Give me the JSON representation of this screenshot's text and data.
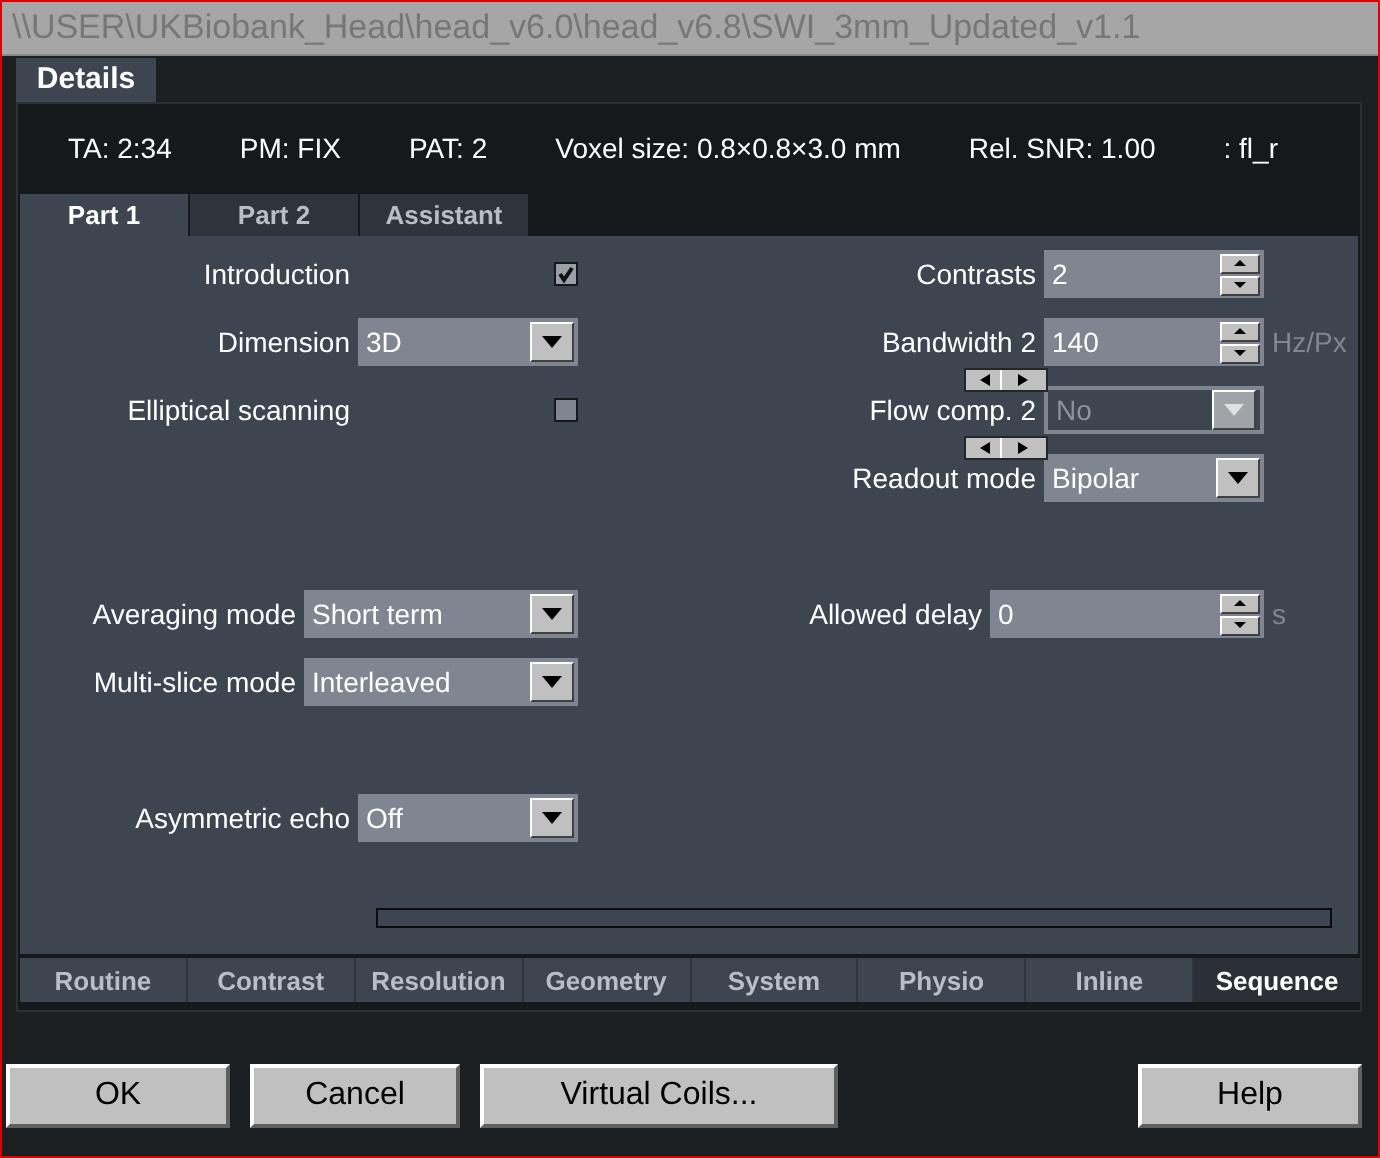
{
  "window": {
    "title": "\\\\USER\\UKBiobank_Head\\head_v6.0\\head_v6.8\\SWI_3mm_Updated_v1.1"
  },
  "top_tab": {
    "label": "Details",
    "selected": true
  },
  "info": [
    "TA: 2:34",
    "PM: FIX",
    "PAT: 2",
    "Voxel size: 0.8×0.8×3.0 mm",
    "Rel. SNR: 1.00",
    ": fl_r"
  ],
  "sub_tabs": [
    {
      "label": "Part 1",
      "selected": true
    },
    {
      "label": "Part 2",
      "selected": false
    },
    {
      "label": "Assistant",
      "selected": false
    }
  ],
  "left_groups": [
    [
      {
        "kind": "checkbox",
        "label": "Introduction",
        "checked": true
      },
      {
        "kind": "dropdown",
        "label": "Dimension",
        "value": "3D"
      },
      {
        "kind": "checkbox",
        "label": "Elliptical scanning",
        "checked": false
      }
    ],
    [
      {
        "kind": "dropdown",
        "label": "Averaging mode",
        "value": "Short term"
      },
      {
        "kind": "dropdown",
        "label": "Multi-slice mode",
        "value": "Interleaved"
      }
    ],
    [
      {
        "kind": "dropdown",
        "label": "Asymmetric echo",
        "value": "Off"
      }
    ]
  ],
  "right_groups": [
    [
      {
        "kind": "spin",
        "label": "Contrasts",
        "value": "2"
      },
      {
        "kind": "spin",
        "label": "Bandwidth 2",
        "value": "140",
        "unit": "Hz/Px",
        "contrast_arrows": true
      },
      {
        "kind": "dropdown",
        "label": "Flow comp. 2",
        "value": "No",
        "disabled": true,
        "contrast_arrows": true
      },
      {
        "kind": "dropdown",
        "label": "Readout mode",
        "value": "Bipolar",
        "disabled": false
      }
    ],
    [
      {
        "kind": "spin",
        "label": "Allowed delay",
        "value": "0",
        "unit": "s"
      }
    ]
  ],
  "progress": {
    "level": 0
  },
  "bottom_tabs": [
    {
      "label": "Routine",
      "selected": false
    },
    {
      "label": "Contrast",
      "selected": false
    },
    {
      "label": "Resolution",
      "selected": false
    },
    {
      "label": "Geometry",
      "selected": false
    },
    {
      "label": "System",
      "selected": false
    },
    {
      "label": "Physio",
      "selected": false
    },
    {
      "label": "Inline",
      "selected": false
    },
    {
      "label": "Sequence",
      "selected": true
    }
  ],
  "buttons": [
    {
      "label": "OK",
      "kind": "left"
    },
    {
      "label": "Cancel",
      "kind": "left"
    },
    {
      "label": "Virtual Coils...",
      "kind": "left"
    },
    {
      "label": "Help",
      "kind": "right"
    }
  ]
}
